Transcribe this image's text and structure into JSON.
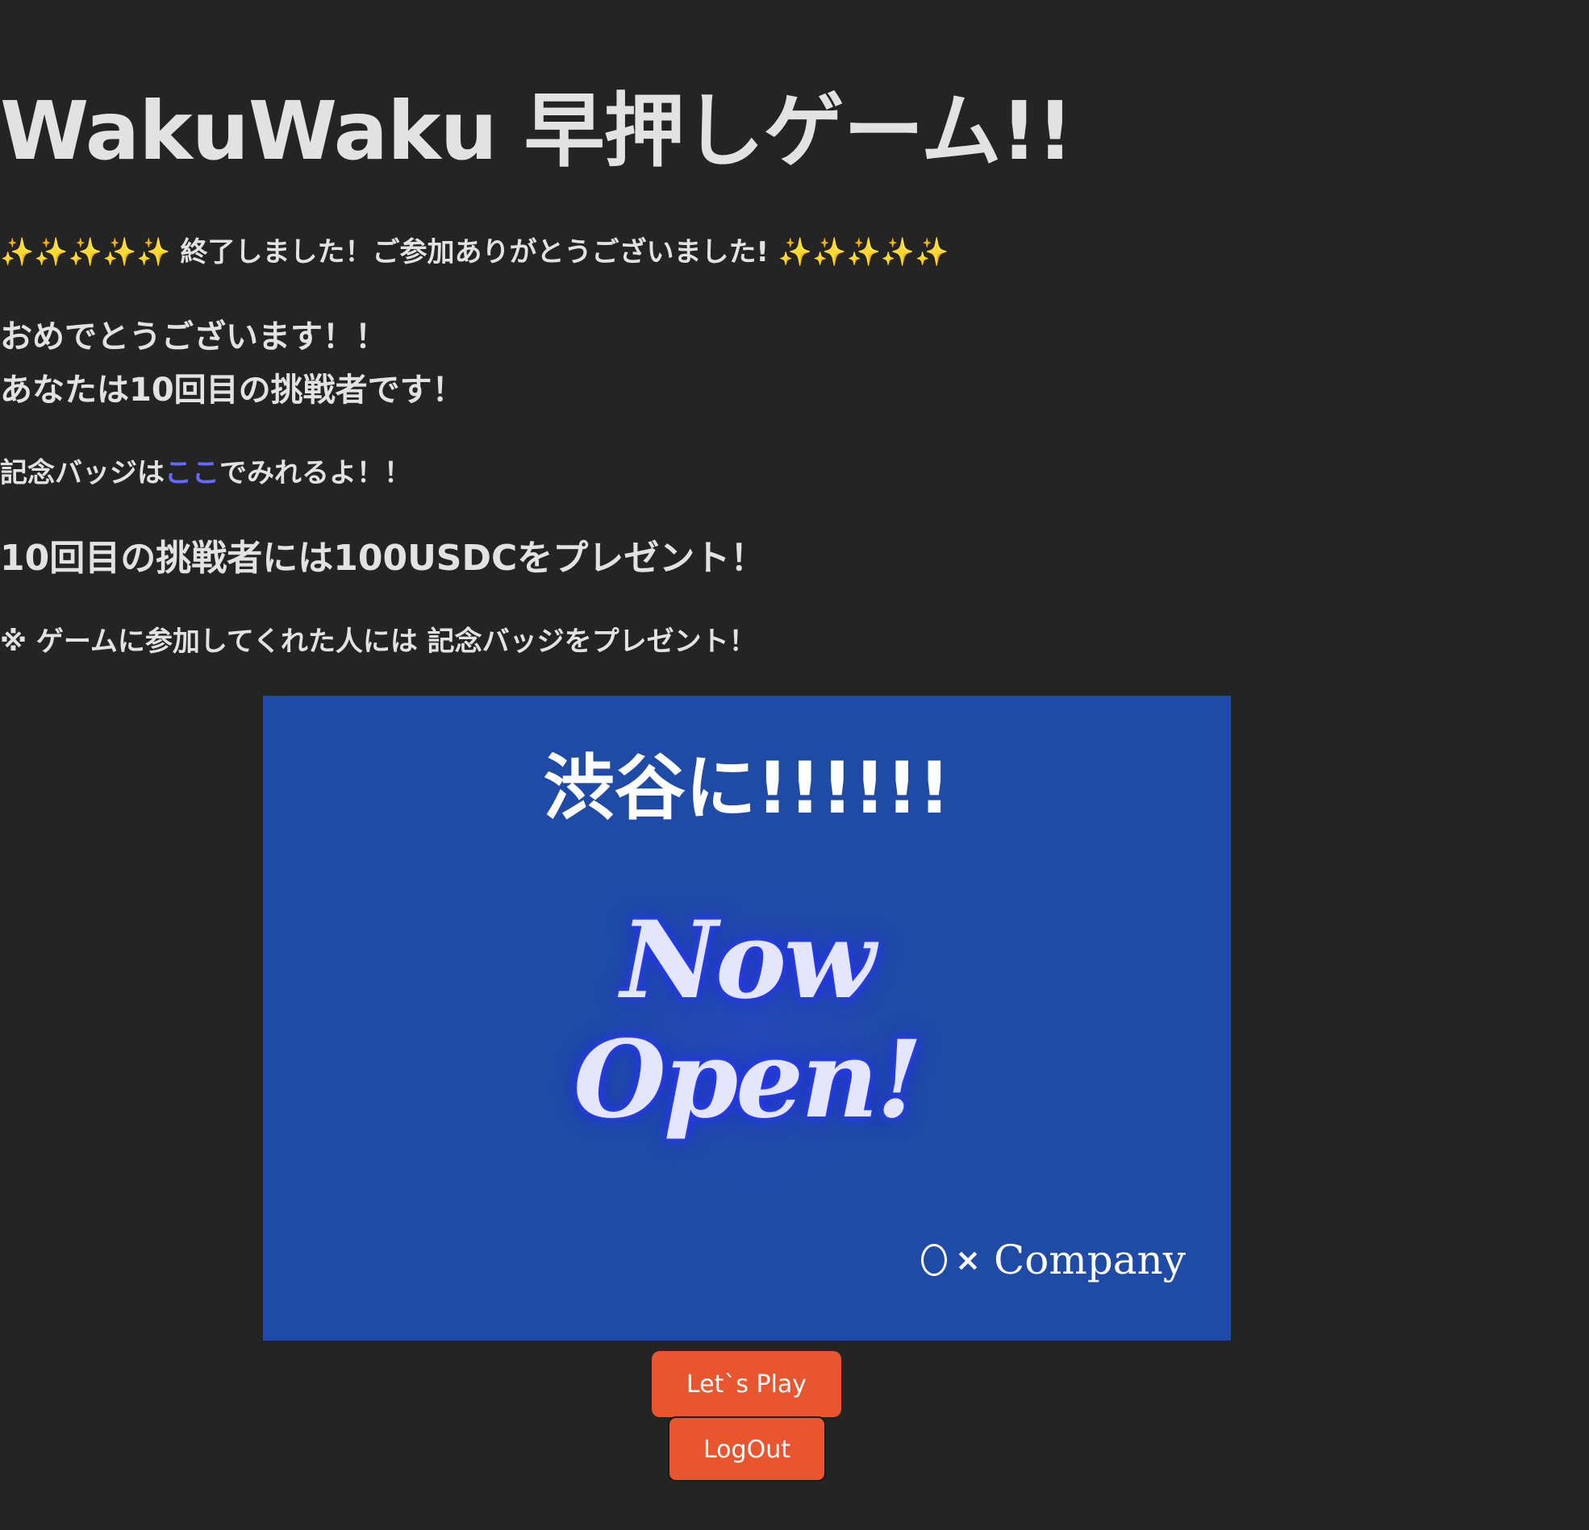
{
  "header": {
    "title": "WakuWaku 早押しゲーム!!"
  },
  "status": {
    "sparkles": "✨✨✨✨✨",
    "message": "終了しました！ご参加ありがとうございました!"
  },
  "result": {
    "line1": "おめでとうございます！！",
    "line2": "あなたは10回目の挑戦者です！"
  },
  "badge": {
    "prefix": "記念バッジは",
    "link_label": "ここ",
    "suffix": "でみれるよ！！"
  },
  "prize": {
    "text": "10回目の挑戦者には100USDCをプレゼント！"
  },
  "note": {
    "text": "※ ゲームに参加してくれた人には 記念バッジをプレゼント！"
  },
  "banner": {
    "heading": "渋谷に!!!!!!",
    "line1": "Now",
    "line2": "Open!",
    "company_symbols": "×",
    "company_name": "Company",
    "background_color": "#1f4aa6"
  },
  "actions": {
    "play_label": "Let`s Play",
    "logout_label": "LogOut",
    "button_color": "#e8552e"
  }
}
